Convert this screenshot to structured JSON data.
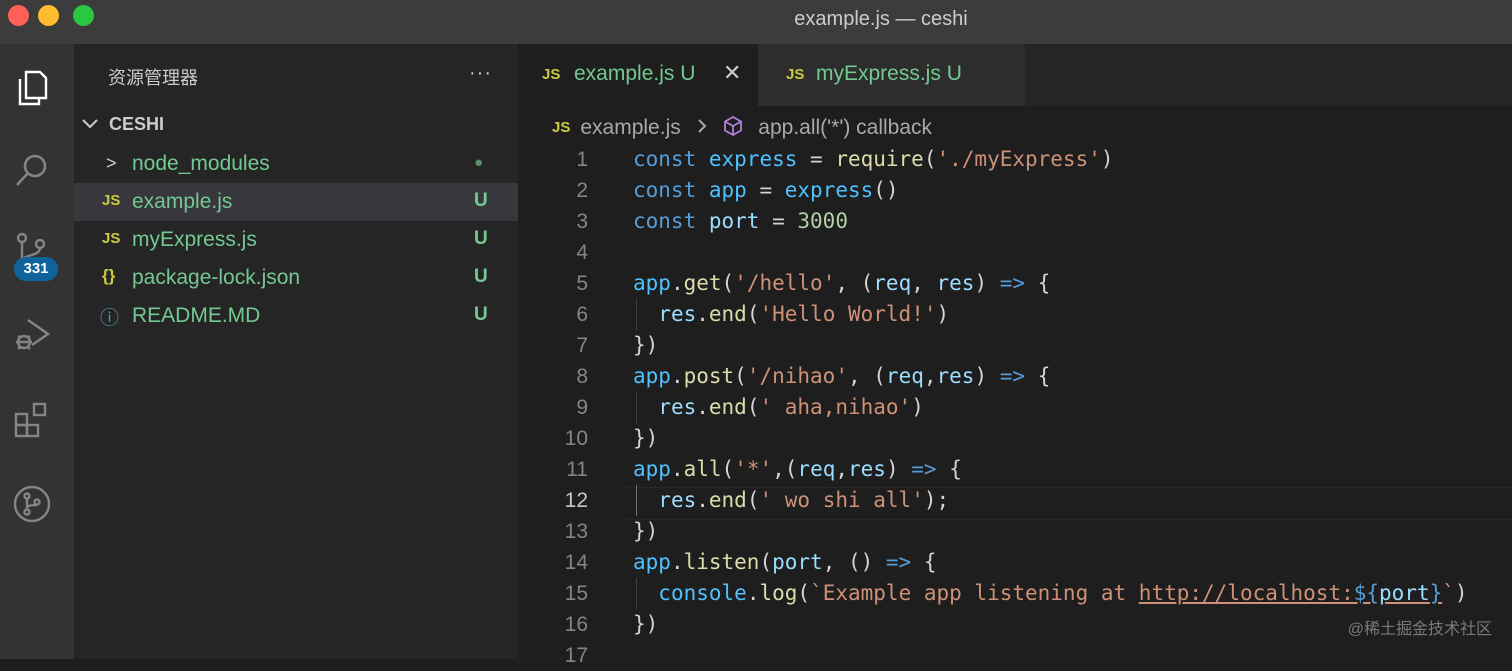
{
  "window": {
    "title": "example.js — ceshi"
  },
  "activity_bar": {
    "source_control_badge": "331"
  },
  "sidebar": {
    "title": "资源管理器",
    "more": "···",
    "folder": "CESHI",
    "items": [
      {
        "icon": ">",
        "name": "node_modules",
        "status": "●"
      },
      {
        "icon": "JS",
        "name": "example.js",
        "status": "U"
      },
      {
        "icon": "JS",
        "name": "myExpress.js",
        "status": "U"
      },
      {
        "icon": "{}",
        "name": "package-lock.json",
        "status": "U"
      },
      {
        "icon": "ⓘ",
        "name": "README.MD",
        "status": "U"
      }
    ]
  },
  "tabs": [
    {
      "icon": "JS",
      "label": "example.js",
      "status": "U",
      "close": "✕"
    },
    {
      "icon": "JS",
      "label": "myExpress.js",
      "status": "U"
    }
  ],
  "breadcrumb": {
    "icon": "JS",
    "file": "example.js",
    "symbol": "app.all('*') callback"
  },
  "editor": {
    "current_line": 12,
    "line_numbers": [
      "1",
      "2",
      "3",
      "4",
      "5",
      "6",
      "7",
      "8",
      "9",
      "10",
      "11",
      "12",
      "13",
      "14",
      "15",
      "16",
      "17"
    ],
    "lines": [
      "const express = require('./myExpress')",
      "const app = express()",
      "const port = 3000",
      "",
      "app.get('/hello', (req, res) => {",
      "  res.end('Hello World!')",
      "})",
      "app.post('/nihao', (req,res) => {",
      "  res.end(' aha,nihao')",
      "})",
      "app.all('*',(req,res) => {",
      "  res.end(' wo shi all');",
      "})",
      "app.listen(port, () => {",
      "  console.log(`Example app listening at http://localhost:${port}`)",
      "})",
      ""
    ]
  },
  "watermark": "@稀土掘金技术社区",
  "colors": {
    "git_untracked": "#73c991",
    "badge": "#0e639c",
    "js_icon": "#cbcb41"
  }
}
